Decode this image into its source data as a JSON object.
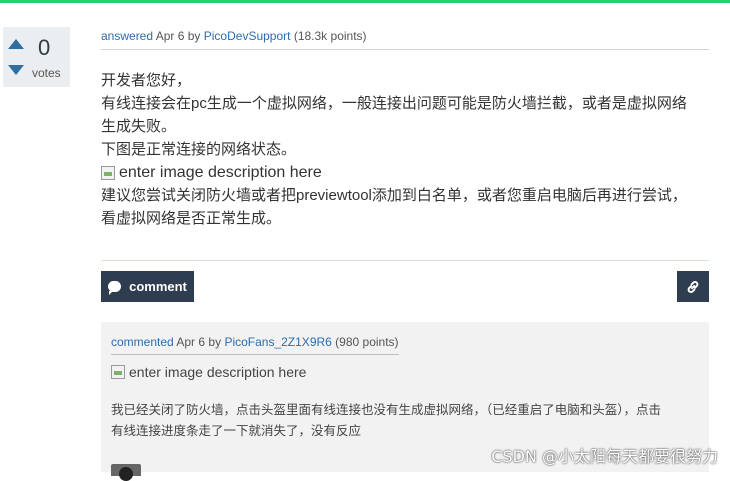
{
  "colors": {
    "accent_bar": "#2ecc71",
    "link": "#2a6db0",
    "button_bg": "#2e3d4f",
    "vote_arrow": "#2f6f9f"
  },
  "votes": {
    "count": "0",
    "label": "votes"
  },
  "answer": {
    "meta": {
      "action": "answered",
      "date": "Apr 6",
      "by": "by",
      "author": "PicoDevSupport",
      "points": "(18.3k points)"
    },
    "paragraphs": [
      "开发者您好，",
      "有线连接会在pc生成一个虚拟网络，一般连接出问题可能是防火墙拦截，或者是虚拟网络生成失败。",
      "下图是正常连接的网络状态。"
    ],
    "image_alt": "enter image description here",
    "suggestion": "建议您尝试关闭防火墙或者把previewtool添加到白名单，或者您重启电脑后再进行尝试，看虚拟网络是否正常生成。"
  },
  "buttons": {
    "comment_label": "comment",
    "comment_icon": "speech-bubble-icon",
    "permalink_icon": "link-icon"
  },
  "comment": {
    "meta": {
      "action": "commented",
      "date": "Apr 6",
      "by": "by",
      "author": "PicoFans_2Z1X9R6",
      "points": "(980 points)"
    },
    "image_alt": "enter image description here",
    "text": "我已经关闭了防火墙，点击头盔里面有线连接也没有生成虚拟网络，（已经重启了电脑和头盔），点击有线连接进度条走了一下就消失了，没有反应"
  },
  "watermark": "CSDN @小太阳每天都要很努力"
}
